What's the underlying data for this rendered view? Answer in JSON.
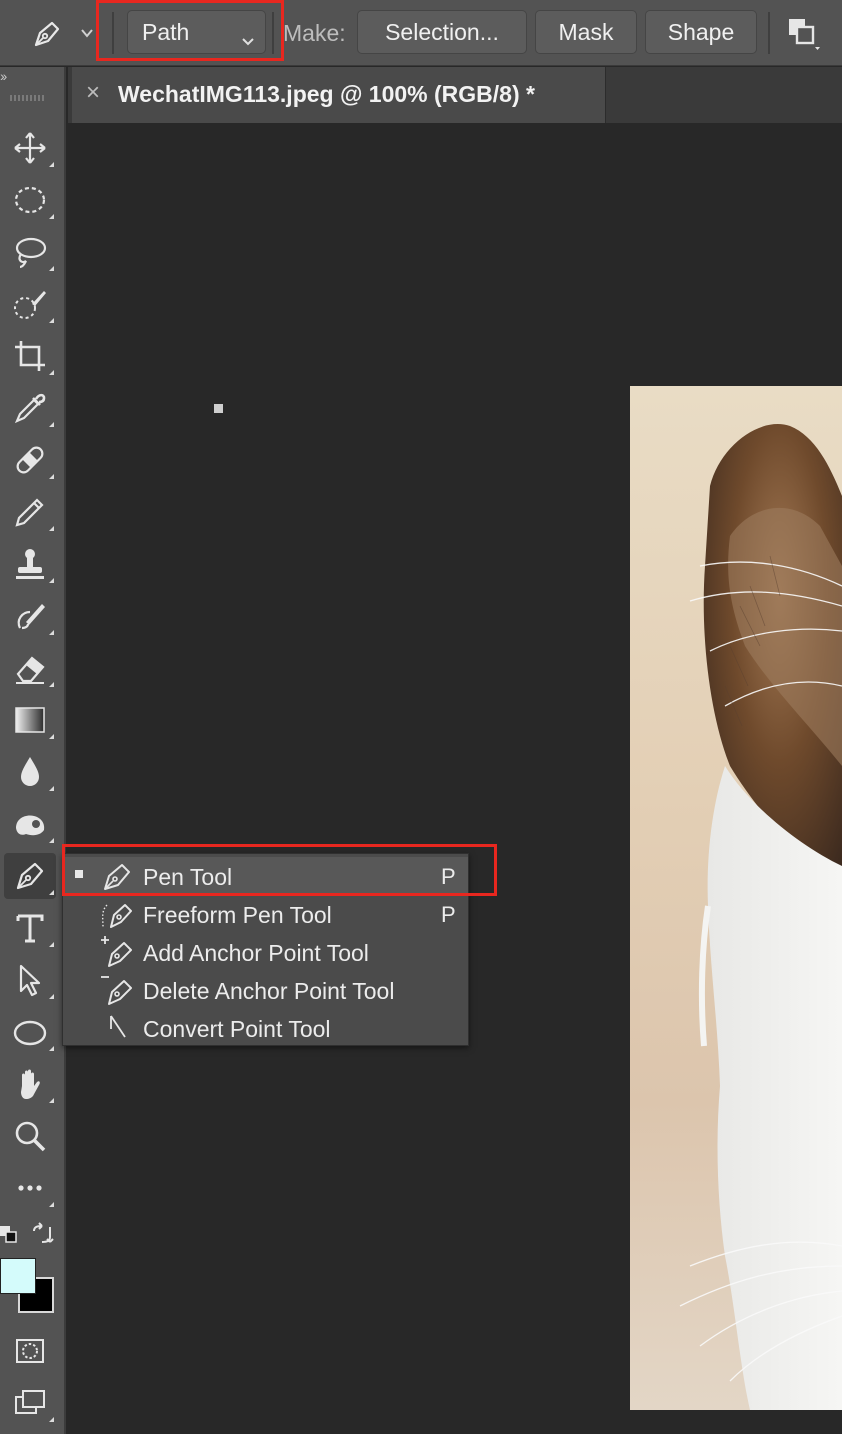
{
  "options_bar": {
    "tool_icon": "pen-icon",
    "path_mode": "Path",
    "make_label": "Make:",
    "buttons": [
      "Selection...",
      "Mask",
      "Shape"
    ],
    "align_icon": "path-operations-icon"
  },
  "document": {
    "tab_title": "WechatIMG113.jpeg @ 100% (RGB/8) *",
    "close_glyph": "×"
  },
  "toolbar": {
    "collapse_glyph": "››",
    "tools": [
      {
        "name": "move-tool",
        "icon": "move-icon"
      },
      {
        "name": "marquee-tool",
        "icon": "ellipse-marquee-icon"
      },
      {
        "name": "lasso-tool",
        "icon": "lasso-icon"
      },
      {
        "name": "quick-selection-tool",
        "icon": "quick-selection-icon"
      },
      {
        "name": "crop-tool",
        "icon": "crop-icon"
      },
      {
        "name": "eyedropper-tool",
        "icon": "eyedropper-icon"
      },
      {
        "name": "healing-brush-tool",
        "icon": "bandage-icon"
      },
      {
        "name": "brush-tool",
        "icon": "pencil-icon"
      },
      {
        "name": "clone-stamp-tool",
        "icon": "stamp-icon"
      },
      {
        "name": "history-brush-tool",
        "icon": "history-brush-icon"
      },
      {
        "name": "eraser-tool",
        "icon": "eraser-icon"
      },
      {
        "name": "gradient-tool",
        "icon": "gradient-icon"
      },
      {
        "name": "blur-tool",
        "icon": "droplet-icon"
      },
      {
        "name": "dodge-tool",
        "icon": "dodge-icon"
      },
      {
        "name": "pen-tool",
        "icon": "pen-icon"
      },
      {
        "name": "type-tool",
        "icon": "type-icon"
      },
      {
        "name": "path-selection-tool",
        "icon": "arrow-icon"
      },
      {
        "name": "ellipse-tool",
        "icon": "ellipse-icon"
      },
      {
        "name": "hand-tool",
        "icon": "hand-icon"
      },
      {
        "name": "zoom-tool",
        "icon": "zoom-icon"
      },
      {
        "name": "more-tools",
        "icon": "more-icon"
      }
    ],
    "foreground_color": "#d4fbfb",
    "background_color": "#000000"
  },
  "flyout": {
    "items": [
      {
        "label": "Pen Tool",
        "shortcut": "P",
        "icon": "pen-icon",
        "selected": true
      },
      {
        "label": "Freeform Pen Tool",
        "shortcut": "P",
        "icon": "freeform-pen-icon",
        "selected": false
      },
      {
        "label": "Add Anchor Point Tool",
        "shortcut": "",
        "icon": "add-anchor-point-icon",
        "selected": false
      },
      {
        "label": "Delete Anchor Point Tool",
        "shortcut": "",
        "icon": "delete-anchor-point-icon",
        "selected": false
      },
      {
        "label": "Convert Point Tool",
        "shortcut": "",
        "icon": "convert-point-icon",
        "selected": false
      }
    ]
  },
  "highlight_color": "#e8271f"
}
